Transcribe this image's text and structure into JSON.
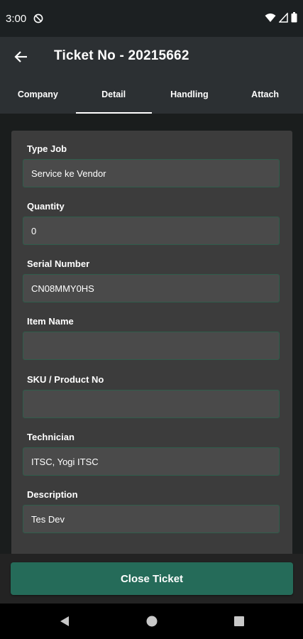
{
  "status_bar": {
    "time": "3:00",
    "icons": [
      "dnd-icon",
      "wifi-icon",
      "signal-icon",
      "battery-icon"
    ]
  },
  "app_bar": {
    "title": "Ticket No - 20215662",
    "back_icon": "arrow-left-icon"
  },
  "tabs": [
    {
      "label": "Company",
      "active": false
    },
    {
      "label": "Detail",
      "active": true
    },
    {
      "label": "Handling",
      "active": false
    },
    {
      "label": "Attach",
      "active": false
    }
  ],
  "form": {
    "fields": [
      {
        "label": "Type Job",
        "value": "Service ke Vendor"
      },
      {
        "label": "Quantity",
        "value": "0"
      },
      {
        "label": "Serial Number",
        "value": "CN08MMY0HS"
      },
      {
        "label": "Item Name",
        "value": ""
      },
      {
        "label": "SKU / Product No",
        "value": ""
      },
      {
        "label": "Technician",
        "value": "ITSC, Yogi ITSC"
      },
      {
        "label": "Description",
        "value": "Tes Dev"
      }
    ]
  },
  "actions": {
    "close_ticket_label": "Close Ticket"
  },
  "nav_bar": {
    "icons": [
      "back-triangle-icon",
      "home-circle-icon",
      "recents-square-icon"
    ]
  },
  "colors": {
    "accent": "#256b59",
    "input_border": "#2f5d4b",
    "card_bg": "#3c3c3c",
    "app_bar_bg": "#2c3033"
  }
}
